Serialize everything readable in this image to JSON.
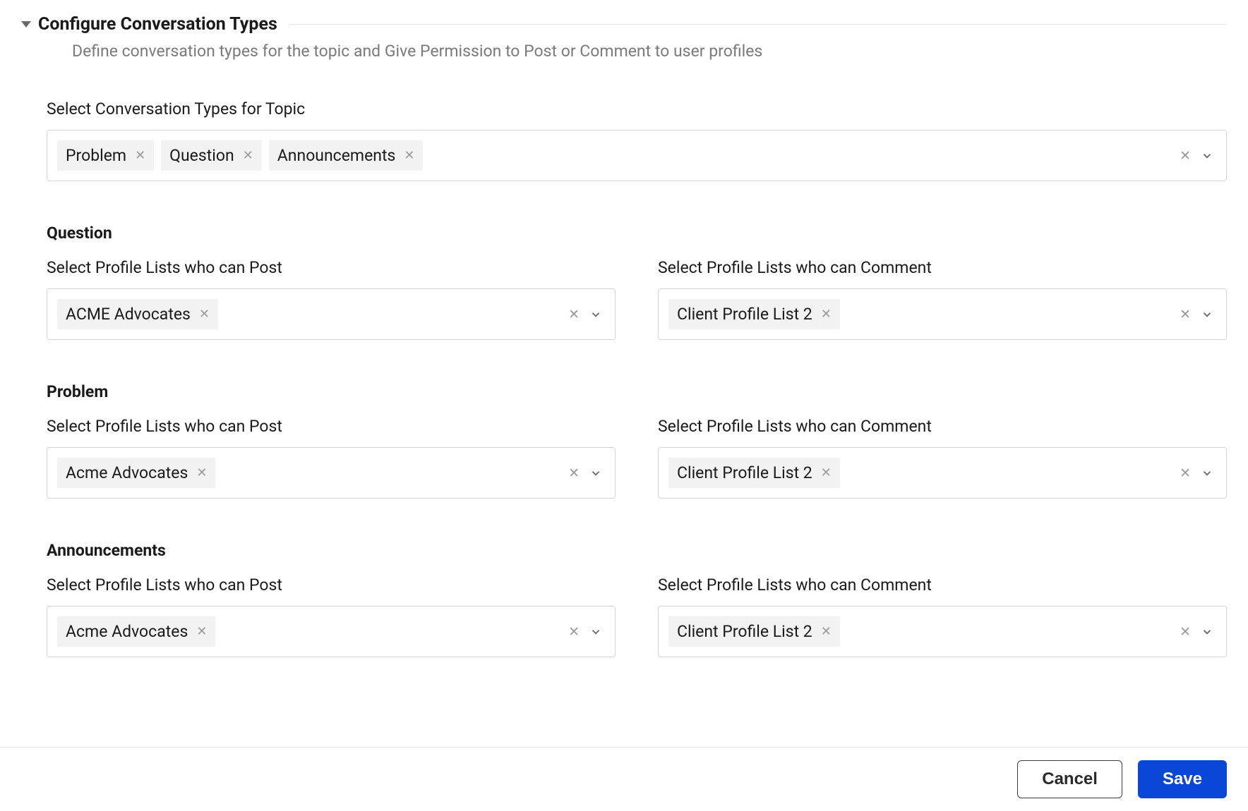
{
  "header": {
    "title": "Configure Conversation Types",
    "subtitle": "Define conversation types for the topic and Give Permission to Post or Comment to user profiles"
  },
  "topicTypes": {
    "label": "Select Conversation Types for Topic",
    "chips": [
      "Problem",
      "Question",
      "Announcements"
    ]
  },
  "sections": [
    {
      "title": "Question",
      "postLabel": "Select Profile Lists who can Post",
      "postChips": [
        "ACME Advocates"
      ],
      "commentLabel": "Select Profile Lists who can Comment",
      "commentChips": [
        "Client Profile List 2"
      ]
    },
    {
      "title": "Problem",
      "postLabel": "Select Profile Lists who can Post",
      "postChips": [
        "Acme Advocates"
      ],
      "commentLabel": "Select Profile Lists who can Comment",
      "commentChips": [
        "Client Profile List 2"
      ]
    },
    {
      "title": "Announcements",
      "postLabel": "Select Profile Lists who can Post",
      "postChips": [
        "Acme Advocates"
      ],
      "commentLabel": "Select Profile Lists who can Comment",
      "commentChips": [
        "Client Profile List 2"
      ]
    }
  ],
  "footer": {
    "cancel": "Cancel",
    "save": "Save"
  }
}
